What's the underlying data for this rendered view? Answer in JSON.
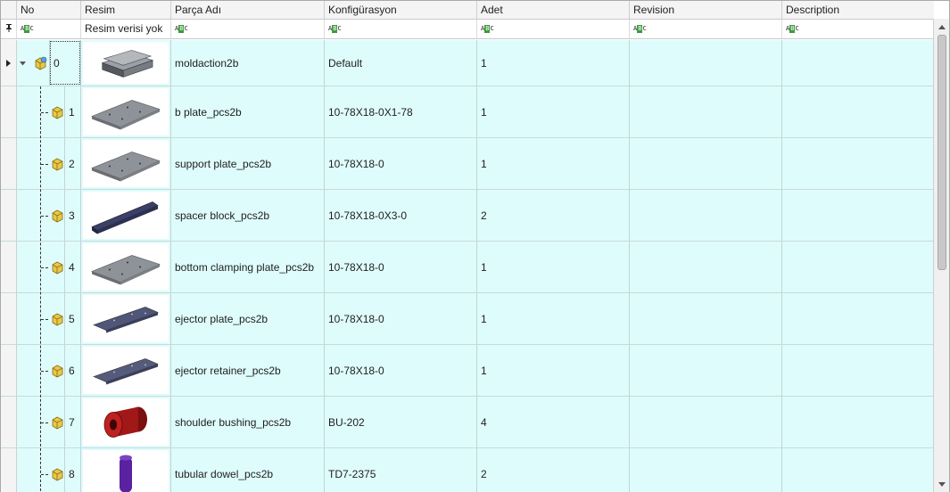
{
  "columns": {
    "no": "No",
    "resim": "Resim",
    "parca_adi": "Parça Adı",
    "konfigurasyon": "Konfigürasyon",
    "adet": "Adet",
    "revision": "Revision",
    "description": "Description"
  },
  "filter": {
    "resim_text": "Resim verisi yok"
  },
  "rows": [
    {
      "no": "0",
      "name": "moldaction2b",
      "config": "Default",
      "qty": "1",
      "revision": "",
      "description": "",
      "thumb": "assembly-stack",
      "color": "#6f7680"
    },
    {
      "no": "1",
      "name": "b plate_pcs2b",
      "config": "10-78X18-0X1-78",
      "qty": "1",
      "revision": "",
      "description": "",
      "thumb": "plate",
      "color": "#8d9399"
    },
    {
      "no": "2",
      "name": "support plate_pcs2b",
      "config": "10-78X18-0",
      "qty": "1",
      "revision": "",
      "description": "",
      "thumb": "plate",
      "color": "#8d9399"
    },
    {
      "no": "3",
      "name": "spacer block_pcs2b",
      "config": "10-78X18-0X3-0",
      "qty": "2",
      "revision": "",
      "description": "",
      "thumb": "bar",
      "color": "#3a4068"
    },
    {
      "no": "4",
      "name": "bottom clamping plate_pcs2b",
      "config": "10-78X18-0",
      "qty": "1",
      "revision": "",
      "description": "",
      "thumb": "plate",
      "color": "#8d9399"
    },
    {
      "no": "5",
      "name": "ejector plate_pcs2b",
      "config": "10-78X18-0",
      "qty": "1",
      "revision": "",
      "description": "",
      "thumb": "strip",
      "color": "#4f5678"
    },
    {
      "no": "6",
      "name": "ejector retainer_pcs2b",
      "config": "10-78X18-0",
      "qty": "1",
      "revision": "",
      "description": "",
      "thumb": "strip",
      "color": "#555b7a"
    },
    {
      "no": "7",
      "name": "shoulder bushing_pcs2b",
      "config": "BU-202",
      "qty": "4",
      "revision": "",
      "description": "",
      "thumb": "cylinder",
      "color": "#a01818"
    },
    {
      "no": "8",
      "name": "tubular dowel_pcs2b",
      "config": "TD7-2375",
      "qty": "2",
      "revision": "",
      "description": "",
      "thumb": "pin",
      "color": "#5a22a0"
    }
  ]
}
